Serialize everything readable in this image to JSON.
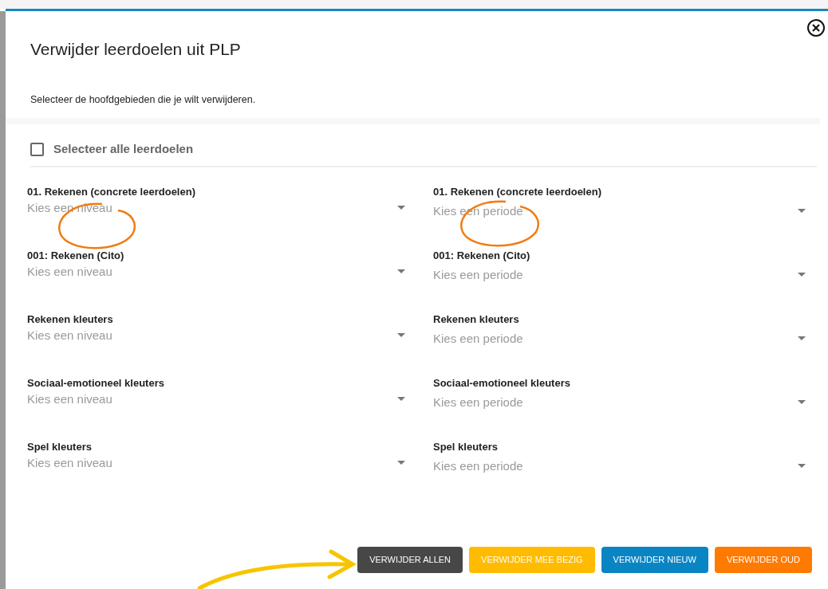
{
  "dialog": {
    "title": "Verwijder leerdoelen uit PLP",
    "instruction": "Selecteer de hoofdgebieden die je wilt verwijderen.",
    "select_all": {
      "label": "Selecteer alle leerdoelen",
      "checked": false
    },
    "rows": [
      {
        "level": {
          "label": "01. Rekenen (concrete leerdoelen)",
          "placeholder": "Kies een niveau"
        },
        "period": {
          "label": "01. Rekenen (concrete leerdoelen)",
          "placeholder": "Kies een periode"
        }
      },
      {
        "level": {
          "label": "001: Rekenen (Cito)",
          "placeholder": "Kies een niveau"
        },
        "period": {
          "label": "001: Rekenen (Cito)",
          "placeholder": "Kies een periode"
        }
      },
      {
        "level": {
          "label": "Rekenen kleuters",
          "placeholder": "Kies een niveau"
        },
        "period": {
          "label": "Rekenen kleuters",
          "placeholder": "Kies een periode"
        }
      },
      {
        "level": {
          "label": "Sociaal-emotioneel kleuters",
          "placeholder": "Kies een niveau"
        },
        "period": {
          "label": "Sociaal-emotioneel kleuters",
          "placeholder": "Kies een periode"
        }
      },
      {
        "level": {
          "label": "Spel kleuters",
          "placeholder": "Kies een niveau"
        },
        "period": {
          "label": "Spel kleuters",
          "placeholder": "Kies een periode"
        }
      }
    ],
    "buttons": [
      {
        "label": "VERWIJDER ALLEN",
        "color": "#474747"
      },
      {
        "label": "VERWIJDER MEE BEZIG",
        "color": "#ffbb00"
      },
      {
        "label": "VERWIJDER NIEUW",
        "color": "#0a85c4"
      },
      {
        "label": "VERWIJDER OUD",
        "color": "#ff7a00"
      }
    ]
  }
}
